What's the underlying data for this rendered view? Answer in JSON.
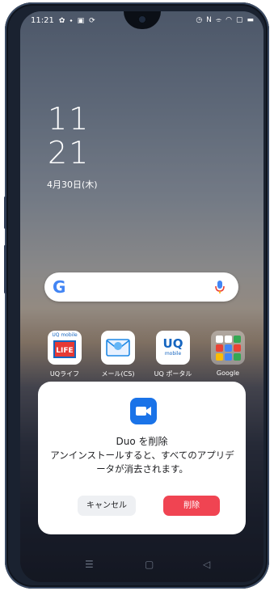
{
  "status_bar": {
    "time": "11:21",
    "left_icons": [
      "gear-icon",
      "location-icon",
      "app-notification-icon",
      "sync-icon"
    ],
    "right_icons": [
      "alarm-icon",
      "nfc-icon",
      "vibrate-icon",
      "wifi-icon",
      "battery-saver-icon",
      "battery-icon"
    ]
  },
  "home": {
    "clock_hour": "11",
    "clock_minute": "21",
    "date": "4月30日(木)"
  },
  "search_bar": {
    "logo": "G",
    "mic_icon": "mic-icon"
  },
  "apps": [
    {
      "label": "UQライフ",
      "icon": "uq-life-icon"
    },
    {
      "label": "メール(CS)",
      "icon": "mail-icon"
    },
    {
      "label": "UQ ポータル",
      "icon": "uq-portal-icon"
    },
    {
      "label": "Google",
      "icon": "google-folder-icon"
    }
  ],
  "app_icon_text": {
    "uq_life_top": "UQ mobile",
    "uq_life_main": "LIFE",
    "uq_portal_main": "UQ",
    "uq_portal_sub": "mobile"
  },
  "dialog": {
    "title": "Duo を削除",
    "message": "アンインストールすると、すべてのアプリデータが消去されます。",
    "cancel_label": "キャンセル",
    "delete_label": "削除"
  },
  "colors": {
    "delete_button": "#f04452",
    "duo_icon": "#1a73e8"
  },
  "nav_bar": [
    "menu-icon",
    "home-icon",
    "back-icon"
  ]
}
